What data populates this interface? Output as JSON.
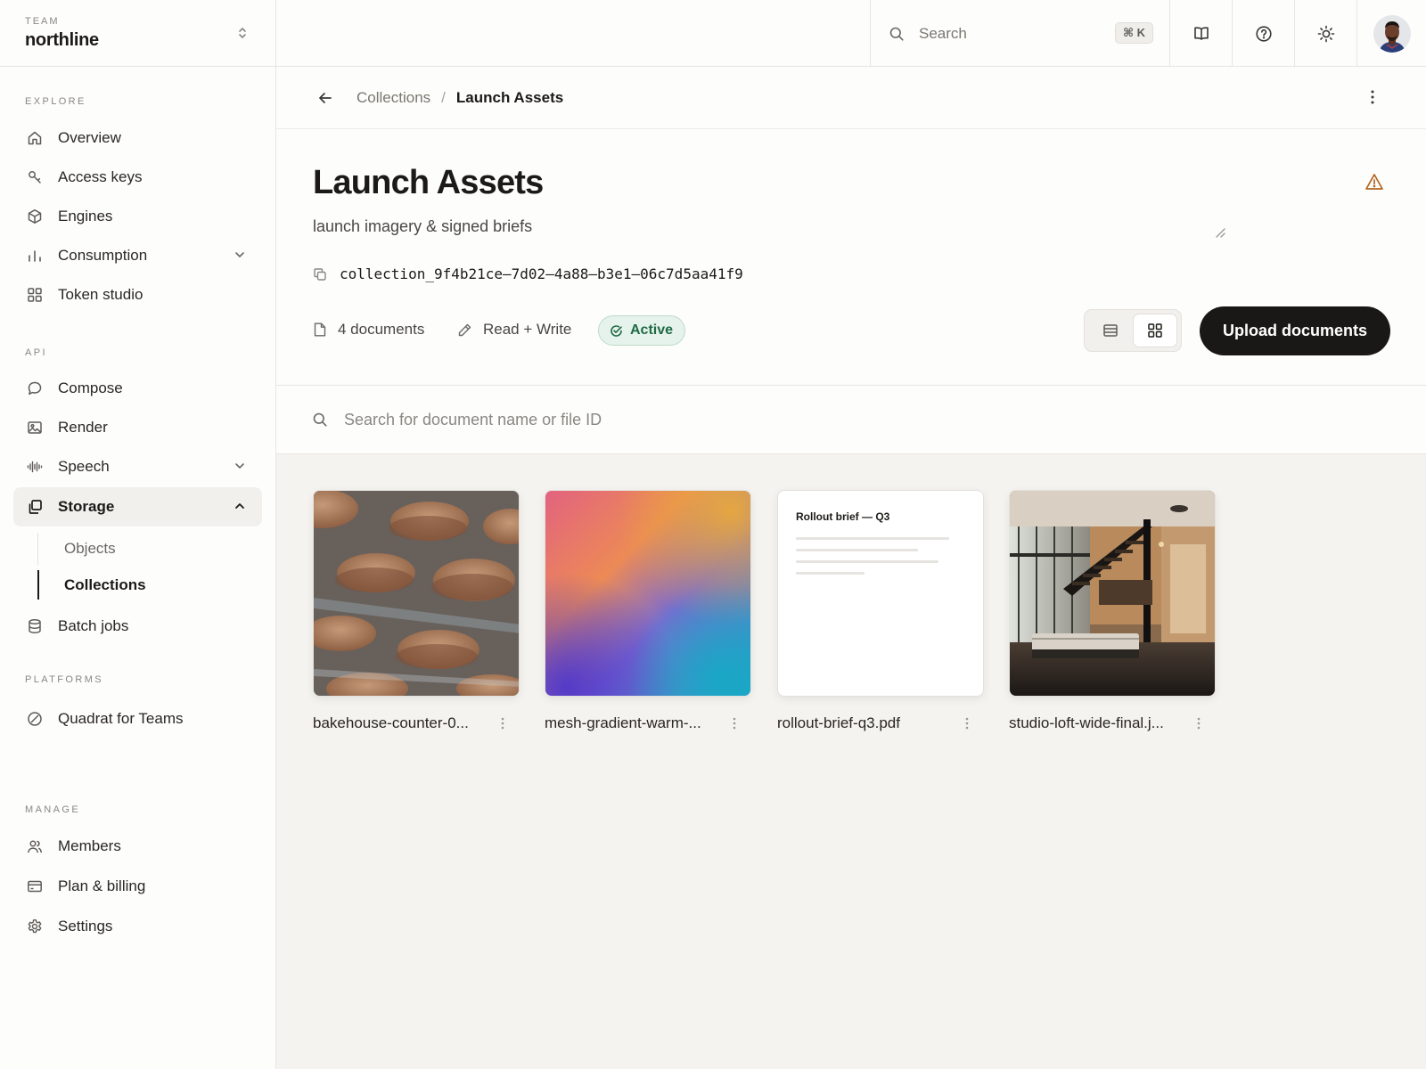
{
  "team": {
    "label": "TEAM",
    "name": "northline"
  },
  "sidebar": {
    "explore_label": "EXPLORE",
    "explore": [
      {
        "label": "Overview",
        "icon": "home-icon"
      },
      {
        "label": "Access keys",
        "icon": "key-icon"
      },
      {
        "label": "Engines",
        "icon": "cube-icon"
      },
      {
        "label": "Consumption",
        "icon": "bar-chart-icon"
      },
      {
        "label": "Token studio",
        "icon": "grid-icon"
      }
    ],
    "api_label": "API",
    "api": [
      {
        "label": "Compose",
        "icon": "chat-bubble-icon"
      },
      {
        "label": "Render",
        "icon": "image-icon"
      },
      {
        "label": "Speech",
        "icon": "waveform-icon"
      },
      {
        "label": "Storage",
        "icon": "copy-stack-icon"
      }
    ],
    "storage_sub": [
      {
        "label": "Objects"
      },
      {
        "label": "Collections"
      }
    ],
    "batch": {
      "label": "Batch jobs",
      "icon": "database-icon"
    },
    "platforms_label": "PLATFORMS",
    "platforms": [
      {
        "label": "Quadrat for Teams",
        "icon": "slash-circle-icon"
      }
    ],
    "manage_label": "MANAGE",
    "manage": [
      {
        "label": "Members",
        "icon": "users-icon"
      },
      {
        "label": "Plan & billing",
        "icon": "credit-card-icon"
      },
      {
        "label": "Settings",
        "icon": "gear-icon"
      }
    ]
  },
  "topbar": {
    "search_placeholder": "Search",
    "shortcut": "⌘ K"
  },
  "breadcrumb": {
    "parent": "Collections",
    "separator": "/",
    "current": "Launch Assets"
  },
  "collection": {
    "title": "Launch Assets",
    "description": "launch imagery & signed briefs",
    "id": "collection_9f4b21ce–7d02–4a88–b3e1–06c7d5aa41f9",
    "documents": "4 documents",
    "permission": "Read + Write",
    "status": "Active",
    "upload_label": "Upload documents"
  },
  "doc_search": {
    "placeholder": "Search for document name or file ID"
  },
  "documents": [
    {
      "name": "bakehouse-counter-0...",
      "kind": "photo-macarons"
    },
    {
      "name": "mesh-gradient-warm-...",
      "kind": "gradient"
    },
    {
      "name": "rollout-brief-q3.pdf",
      "kind": "pdf",
      "preview_title": "Rollout brief — Q3"
    },
    {
      "name": "studio-loft-wide-final.j...",
      "kind": "photo-loft"
    }
  ],
  "colors": {
    "accent": "#1a1816",
    "active_badge": "#1f6b45",
    "warning": "#b2641f",
    "canvas": "#f4f3ef"
  }
}
